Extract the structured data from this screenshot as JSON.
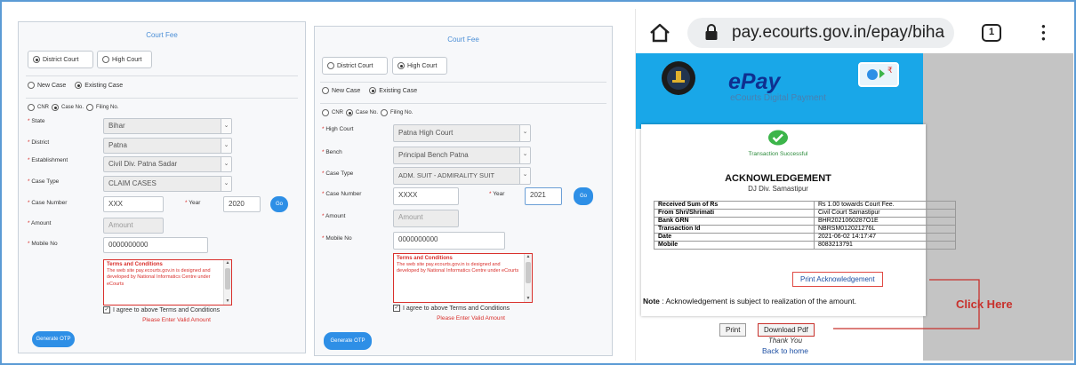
{
  "district_panel": {
    "title": "Court Fee",
    "court_options": [
      "District Court",
      "High Court"
    ],
    "case_options": [
      "New Case",
      "Existing Case"
    ],
    "search_options": [
      "CNR",
      "Case No.",
      "Filing No."
    ],
    "fields": [
      {
        "label": "State",
        "value": "Bihar"
      },
      {
        "label": "District",
        "value": "Patna"
      },
      {
        "label": "Establishment",
        "value": "Civil Div. Patna Sadar"
      },
      {
        "label": "Case Type",
        "value": "CLAIM CASES"
      }
    ],
    "case_number_label": "Case Number",
    "case_number_value": "XXX",
    "year_label": "Year",
    "year_value": "2020",
    "go_label": "Go",
    "amount_label": "Amount",
    "amount_placeholder": "Amount",
    "mobile_label": "Mobile No",
    "mobile_value": "0000000000",
    "terms_title": "Terms and Conditions",
    "terms_text": "The web site pay.ecourts.gov.in is designed and developed by National Informatics Centre under eCourts",
    "agree_label": "I agree to above Terms and Conditions",
    "warning": "Please Enter Valid Amount",
    "otp_label": "Generate OTP"
  },
  "high_court_panel": {
    "title": "Court Fee",
    "court_options": [
      "District Court",
      "High Court"
    ],
    "case_options": [
      "New Case",
      "Existing Case"
    ],
    "search_options": [
      "CNR",
      "Case No.",
      "Filing No."
    ],
    "fields": [
      {
        "label": "High Court",
        "value": "Patna High Court"
      },
      {
        "label": "Bench",
        "value": "Principal Bench Patna"
      },
      {
        "label": "Case Type",
        "value": "ADM. SUIT - ADMIRALITY SUIT"
      }
    ],
    "case_number_label": "Case Number",
    "case_number_value": "XXXX",
    "year_label": "Year",
    "year_value": "2021",
    "go_label": "Go",
    "amount_label": "Amount",
    "amount_placeholder": "Amount",
    "mobile_label": "Mobile No",
    "mobile_value": "0000000000",
    "terms_title": "Terms and Conditions",
    "terms_text": "The web site pay.ecourts.gov.in is designed and developed by National Informatics Centre under eCourts",
    "agree_label": "I agree to above Terms and Conditions",
    "warning": "Please Enter Valid Amount",
    "otp_label": "Generate OTP"
  },
  "browser": {
    "url": "pay.ecourts.gov.in/epay/biha",
    "tab_count": "1"
  },
  "epay": {
    "title": "ePay",
    "subtitle": "eCourts Digital Payment"
  },
  "receipt": {
    "status": "Transaction Successful",
    "heading": "ACKNOWLEDGEMENT",
    "office": "DJ Div. Samastipur",
    "rows": [
      {
        "label": "Received Sum of Rs",
        "value": "Rs 1.00 towards Court Fee."
      },
      {
        "label": "From Shri/Shrimati",
        "value": "Civil Court Samastipur"
      },
      {
        "label": "Bank GRN",
        "value": "BHR2021060287O1E"
      },
      {
        "label": "Transaction Id",
        "value": "NBRSM012021276L"
      },
      {
        "label": "Date",
        "value": "2021-06-02 14:17:47"
      },
      {
        "label": "Mobile",
        "value": "8083213791"
      }
    ],
    "print_ack": "Print Acknowledgement",
    "note_label": "Note",
    "note_text": " : Acknowledgement is subject to realization of the amount.",
    "click_here": "Click Here",
    "print": "Print",
    "download": "Download Pdf",
    "thanks": "Thank You",
    "back": "Back to home"
  },
  "colors": {
    "accent_blue": "#2e8fe6",
    "error_red": "#d9302c",
    "epay_banner": "#19a7e8",
    "success_green": "#3cb54a",
    "annotation_red": "#c8312c"
  }
}
